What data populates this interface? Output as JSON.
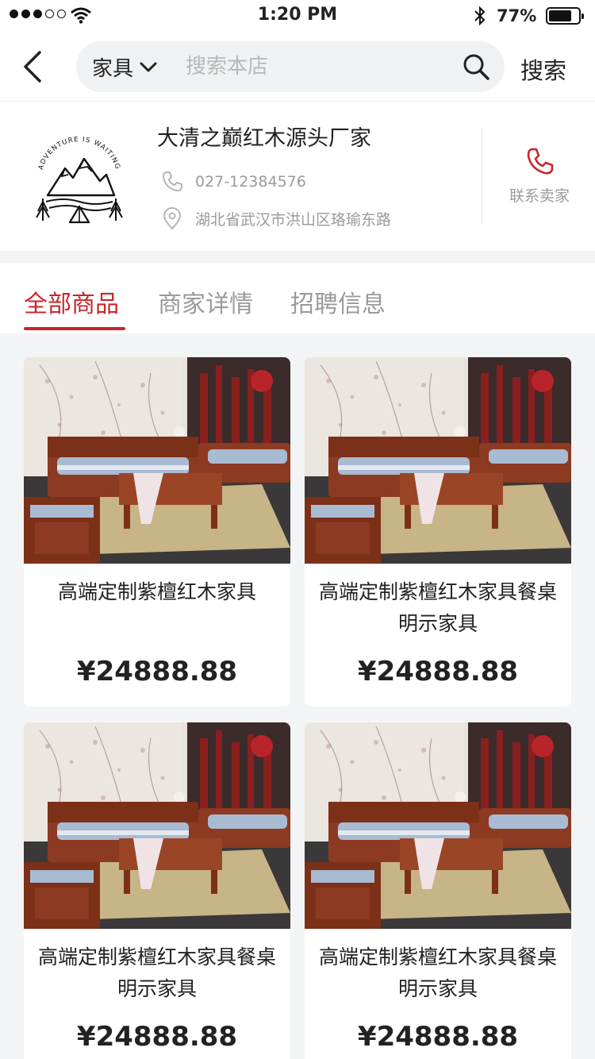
{
  "status_bar": {
    "time": "1:20 PM",
    "battery": "77%",
    "battery_level": 0.77
  },
  "nav": {
    "category": "家具",
    "search_placeholder": "搜索本店",
    "search_button": "搜索"
  },
  "store": {
    "name": "大清之巅红木源头厂家",
    "phone": "027-12384576",
    "address": "湖北省武汉市洪山区珞瑜东路",
    "contact_label": "联系卖家",
    "logo_text_top": "ADVENTURE IS WAITING"
  },
  "tabs": [
    {
      "label": "全部商品",
      "active": true
    },
    {
      "label": "商家详情",
      "active": false
    },
    {
      "label": "招聘信息",
      "active": false
    }
  ],
  "products": [
    {
      "title": "高端定制紫檀红木家具",
      "price": "¥24888.88"
    },
    {
      "title": "高端定制紫檀红木家具餐桌明示家具",
      "price": "¥24888.88"
    },
    {
      "title": "高端定制紫檀红木家具餐桌明示家具",
      "price": "¥24888.88"
    },
    {
      "title": "高端定制紫檀红木家具餐桌明示家具",
      "price": "¥24888.88"
    }
  ],
  "colors": {
    "accent": "#c8262c",
    "muted": "#9a9a9a",
    "background": "#f3f4f6"
  },
  "icons": {
    "back": "chevron-left-icon",
    "dropdown": "chevron-down-icon",
    "search": "search-icon",
    "phone": "phone-icon",
    "location": "location-pin-icon",
    "call": "call-icon"
  }
}
